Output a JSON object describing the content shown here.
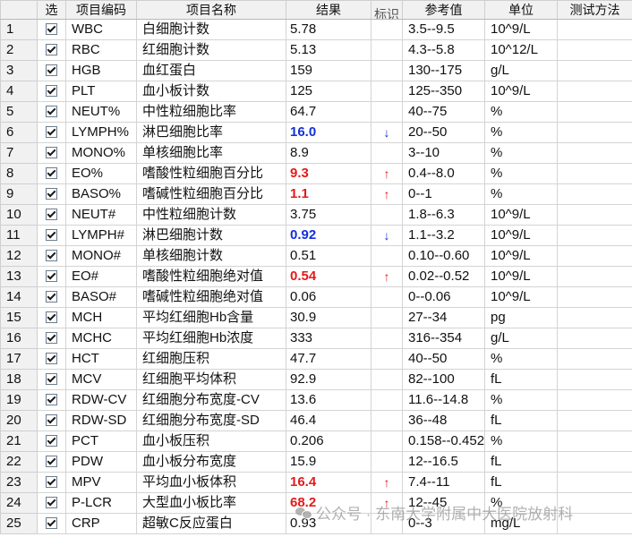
{
  "columns": {
    "index": "",
    "select": "选",
    "code": "项目编码",
    "name": "项目名称",
    "result": "结果",
    "flag": "标识",
    "reference": "参考值",
    "unit": "单位",
    "method": "测试方法"
  },
  "rows": [
    {
      "index": "1",
      "checked": true,
      "code": "WBC",
      "name": "白细胞计数",
      "result": "5.78",
      "flag": "",
      "reference": "3.5--9.5",
      "unit": "10^9/L"
    },
    {
      "index": "2",
      "checked": true,
      "code": "RBC",
      "name": "红细胞计数",
      "result": "5.13",
      "flag": "",
      "reference": "4.3--5.8",
      "unit": "10^12/L"
    },
    {
      "index": "3",
      "checked": true,
      "code": "HGB",
      "name": "血红蛋白",
      "result": "159",
      "flag": "",
      "reference": "130--175",
      "unit": "g/L"
    },
    {
      "index": "4",
      "checked": true,
      "code": "PLT",
      "name": "血小板计数",
      "result": "125",
      "flag": "",
      "reference": "125--350",
      "unit": "10^9/L"
    },
    {
      "index": "5",
      "checked": true,
      "code": "NEUT%",
      "name": "中性粒细胞比率",
      "result": "64.7",
      "flag": "",
      "reference": "40--75",
      "unit": "%"
    },
    {
      "index": "6",
      "checked": true,
      "code": "LYMPH%",
      "name": "淋巴细胞比率",
      "result": "16.0",
      "flag": "low",
      "reference": "20--50",
      "unit": "%"
    },
    {
      "index": "7",
      "checked": true,
      "code": "MONO%",
      "name": "单核细胞比率",
      "result": "8.9",
      "flag": "",
      "reference": "3--10",
      "unit": "%"
    },
    {
      "index": "8",
      "checked": true,
      "code": "EO%",
      "name": "嗜酸性粒细胞百分比",
      "result": "9.3",
      "flag": "high",
      "reference": "0.4--8.0",
      "unit": "%"
    },
    {
      "index": "9",
      "checked": true,
      "code": "BASO%",
      "name": "嗜碱性粒细胞百分比",
      "result": "1.1",
      "flag": "high",
      "reference": "0--1",
      "unit": "%"
    },
    {
      "index": "10",
      "checked": true,
      "code": "NEUT#",
      "name": "中性粒细胞计数",
      "result": "3.75",
      "flag": "",
      "reference": "1.8--6.3",
      "unit": "10^9/L"
    },
    {
      "index": "11",
      "checked": true,
      "code": "LYMPH#",
      "name": "淋巴细胞计数",
      "result": "0.92",
      "flag": "low",
      "reference": "1.1--3.2",
      "unit": "10^9/L"
    },
    {
      "index": "12",
      "checked": true,
      "code": "MONO#",
      "name": "单核细胞计数",
      "result": "0.51",
      "flag": "",
      "reference": "0.10--0.60",
      "unit": "10^9/L"
    },
    {
      "index": "13",
      "checked": true,
      "code": "EO#",
      "name": "嗜酸性粒细胞绝对值",
      "result": "0.54",
      "flag": "high",
      "reference": "0.02--0.52",
      "unit": "10^9/L"
    },
    {
      "index": "14",
      "checked": true,
      "code": "BASO#",
      "name": "嗜碱性粒细胞绝对值",
      "result": "0.06",
      "flag": "",
      "reference": "0--0.06",
      "unit": "10^9/L"
    },
    {
      "index": "15",
      "checked": true,
      "code": "MCH",
      "name": "平均红细胞Hb含量",
      "result": "30.9",
      "flag": "",
      "reference": "27--34",
      "unit": "pg"
    },
    {
      "index": "16",
      "checked": true,
      "code": "MCHC",
      "name": "平均红细胞Hb浓度",
      "result": "333",
      "flag": "",
      "reference": "316--354",
      "unit": "g/L"
    },
    {
      "index": "17",
      "checked": true,
      "code": "HCT",
      "name": "红细胞压积",
      "result": "47.7",
      "flag": "",
      "reference": "40--50",
      "unit": "%"
    },
    {
      "index": "18",
      "checked": true,
      "code": "MCV",
      "name": "红细胞平均体积",
      "result": "92.9",
      "flag": "",
      "reference": "82--100",
      "unit": "fL"
    },
    {
      "index": "19",
      "checked": true,
      "code": "RDW-CV",
      "name": "红细胞分布宽度-CV",
      "result": "13.6",
      "flag": "",
      "reference": "11.6--14.8",
      "unit": "%"
    },
    {
      "index": "20",
      "checked": true,
      "code": "RDW-SD",
      "name": "红细胞分布宽度-SD",
      "result": "46.4",
      "flag": "",
      "reference": "36--48",
      "unit": "fL"
    },
    {
      "index": "21",
      "checked": true,
      "code": "PCT",
      "name": "血小板压积",
      "result": "0.206",
      "flag": "",
      "reference": "0.158--0.452",
      "unit": "%"
    },
    {
      "index": "22",
      "checked": true,
      "code": "PDW",
      "name": "血小板分布宽度",
      "result": "15.9",
      "flag": "",
      "reference": "12--16.5",
      "unit": "fL"
    },
    {
      "index": "23",
      "checked": true,
      "code": "MPV",
      "name": "平均血小板体积",
      "result": "16.4",
      "flag": "high",
      "reference": "7.4--11",
      "unit": "fL"
    },
    {
      "index": "24",
      "checked": true,
      "code": "P-LCR",
      "name": "大型血小板比率",
      "result": "68.2",
      "flag": "high",
      "reference": "12--45",
      "unit": "%"
    },
    {
      "index": "25",
      "checked": true,
      "code": "CRP",
      "name": "超敏C反应蛋白",
      "result": "0.93",
      "flag": "",
      "reference": "0--3",
      "unit": "mg/L"
    }
  ],
  "flag_icons": {
    "high": "arrow-up-icon",
    "low": "arrow-down-icon"
  },
  "flag_glyphs": {
    "high": "↑",
    "low": "↓"
  },
  "colors": {
    "high": "#e51a1a",
    "low": "#1230d9",
    "header_bg": "#f1f1f1",
    "grid_line": "#d4d4d4"
  },
  "watermark": {
    "text": "公众号 · 东南大学附属中大医院放射科",
    "icon": "wechat-icon"
  }
}
